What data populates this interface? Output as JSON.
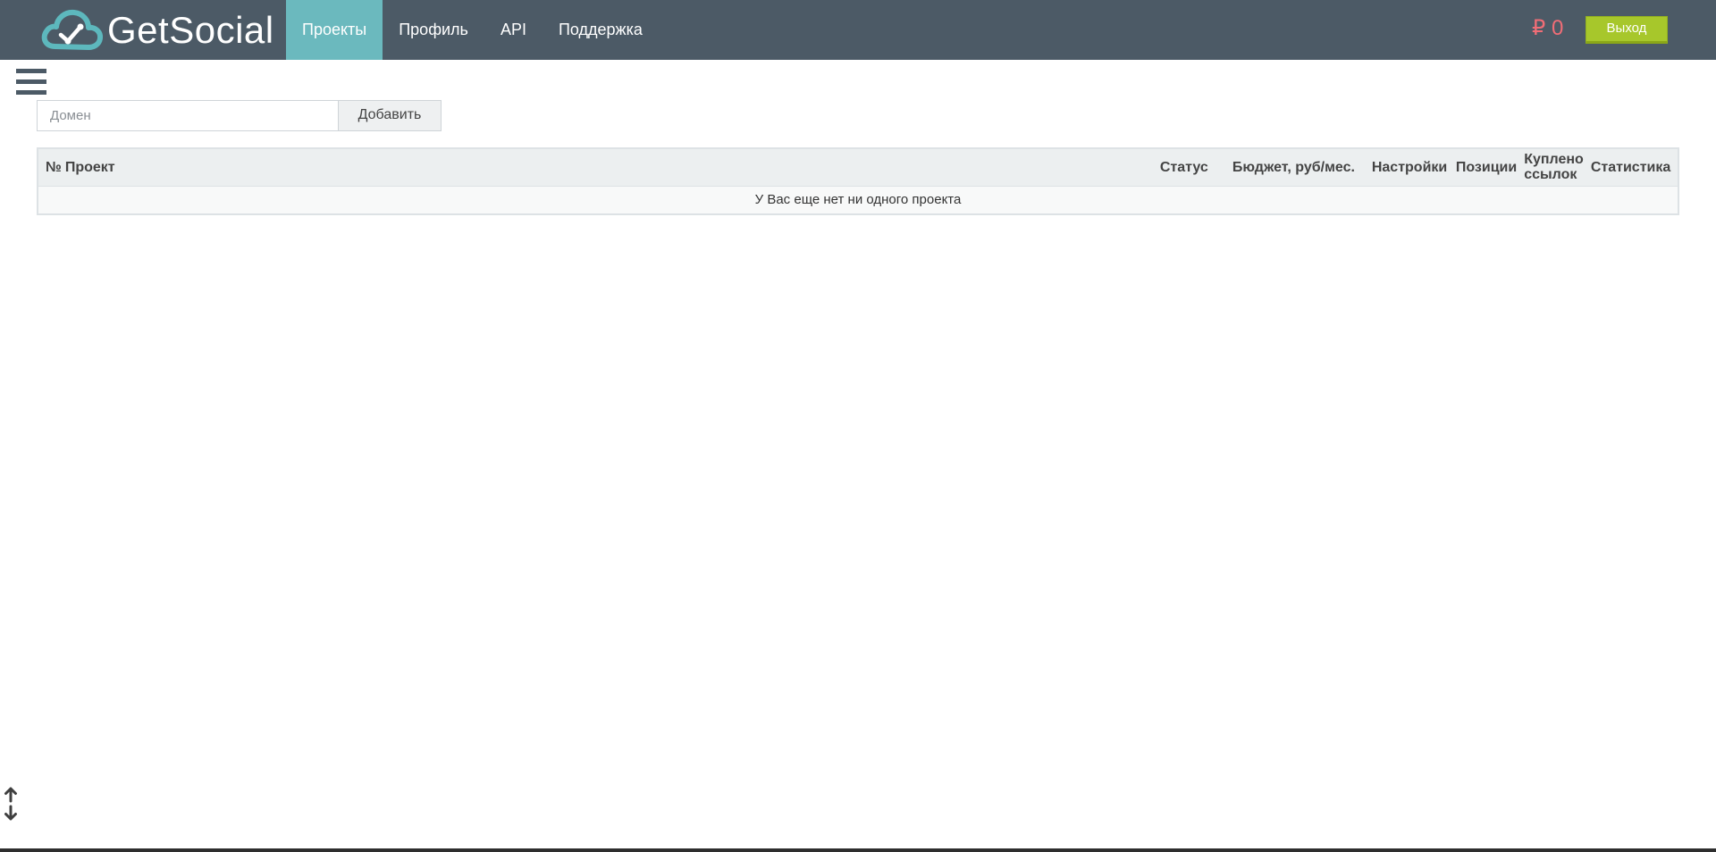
{
  "brand": {
    "name": "GetSocial",
    "accent": "#6bb9be",
    "navbar_bg": "#4c5a66"
  },
  "nav": {
    "items": [
      {
        "label": "Проекты",
        "active": true
      },
      {
        "label": "Профиль",
        "active": false
      },
      {
        "label": "API",
        "active": false
      },
      {
        "label": "Поддержка",
        "active": false
      }
    ]
  },
  "account": {
    "balance": "₽ 0",
    "balance_color": "#f06d76",
    "logout_label": "Выход",
    "logout_color": "#a7c72b"
  },
  "menu": {
    "icon": "hamburger-icon"
  },
  "add_form": {
    "domain_placeholder": "Домен",
    "domain_value": "",
    "add_label": "Добавить"
  },
  "table": {
    "columns": [
      "№",
      "Проект",
      "Статус",
      "Бюджет, руб/мес.",
      "Настройки",
      "Позиции",
      "Куплено ссылок",
      "Статистика"
    ],
    "empty_message": "У Вас еще нет ни одного проекта"
  },
  "scroll": {
    "up_icon": "arrow-up-icon",
    "down_icon": "arrow-down-icon"
  }
}
